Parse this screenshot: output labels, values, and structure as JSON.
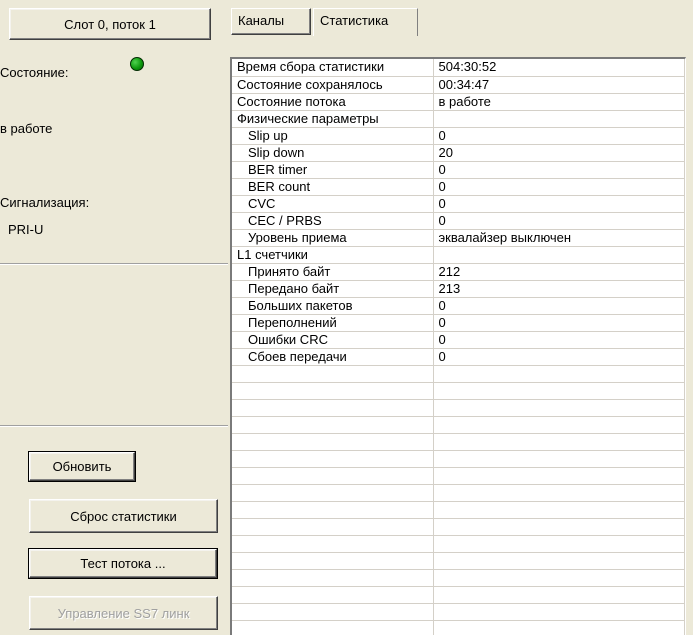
{
  "left_panel": {
    "slot_label": "Слот 0, поток 1",
    "state_label": "Состояние:",
    "state_value": "в работе",
    "signaling_label": "Сигнализация:",
    "signaling_value": "PRI-U",
    "led_color": "#119b11",
    "buttons": {
      "refresh": "Обновить",
      "reset_stats": "Сброс статистики",
      "stream_test": "Тест потока ...",
      "ss7_control": "Управление SS7 линк"
    }
  },
  "tabs": [
    "Каналы",
    "Статистика"
  ],
  "active_tab": "Статистика",
  "stats_rows": [
    [
      "Время сбора статистики",
      "504:30:52"
    ],
    [
      "Состояние сохранялось",
      "00:34:47"
    ],
    [
      "Состояние потока",
      "в работе"
    ],
    [
      "Физические параметры",
      ""
    ],
    [
      "Slip up",
      "0"
    ],
    [
      "Slip down",
      "20"
    ],
    [
      "BER timer",
      "0"
    ],
    [
      "BER count",
      "0"
    ],
    [
      "CVC",
      "0"
    ],
    [
      "CEC / PRBS",
      "0"
    ],
    [
      "Уровень приема",
      " эквалайзер выключен"
    ],
    [
      "L1 счетчики",
      ""
    ],
    [
      "Принято байт",
      "212"
    ],
    [
      "Передано байт",
      "213"
    ],
    [
      "Больших пакетов",
      "0"
    ],
    [
      "Переполнений",
      "0"
    ],
    [
      "Ошибки CRC",
      "0"
    ],
    [
      "Сбоев передачи",
      "0"
    ],
    [
      "",
      ""
    ],
    [
      "",
      ""
    ],
    [
      "",
      ""
    ],
    [
      "",
      ""
    ],
    [
      "",
      ""
    ],
    [
      "",
      ""
    ],
    [
      "",
      ""
    ],
    [
      "",
      ""
    ],
    [
      "",
      ""
    ],
    [
      "",
      ""
    ],
    [
      "",
      ""
    ],
    [
      "",
      ""
    ],
    [
      "",
      ""
    ],
    [
      "",
      ""
    ],
    [
      "",
      ""
    ],
    [
      "",
      ""
    ]
  ],
  "indented_rows": [
    4,
    5,
    6,
    7,
    8,
    9,
    10,
    12,
    13,
    14,
    15,
    16,
    17
  ]
}
